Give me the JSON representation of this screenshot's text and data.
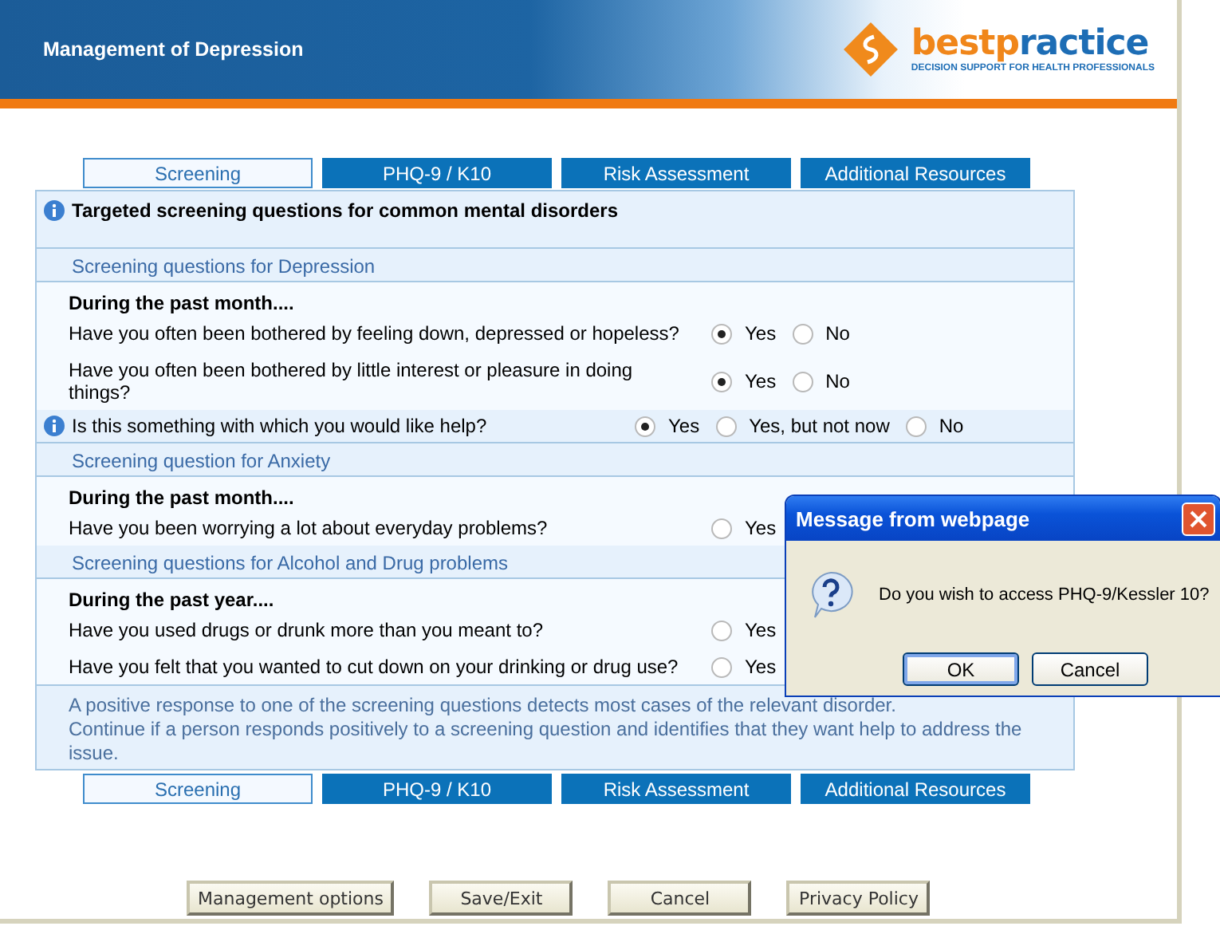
{
  "header": {
    "title": "Management of Depression",
    "logo_parts": [
      {
        "text": "bestp",
        "color": "#f0861a"
      },
      {
        "text": "ractice",
        "color": "#1d6db5"
      }
    ],
    "tagline": "DECISION SUPPORT FOR HEALTH PROFESSIONALS"
  },
  "tabs_top": [
    {
      "label": "Screening",
      "selected": true
    },
    {
      "label": "PHQ-9 / K10",
      "selected": false
    },
    {
      "label": "Risk Assessment",
      "selected": false
    },
    {
      "label": "Additional Resources",
      "selected": false
    }
  ],
  "rows": [
    {
      "kind": "intro",
      "text": "Targeted screening questions for common mental disorders"
    },
    {
      "kind": "section",
      "text": "Screening questions for Depression"
    },
    {
      "kind": "lead",
      "text": "During the past month...."
    },
    {
      "kind": "question",
      "text": "Have you often been bothered by feeling down, depressed or hopeless?",
      "options": [
        {
          "label": "Yes",
          "selected": true
        },
        {
          "label": "No",
          "selected": false
        }
      ]
    },
    {
      "kind": "question",
      "text": "Have you often been bothered by little interest or pleasure in doing things?",
      "options": [
        {
          "label": "Yes",
          "selected": true
        },
        {
          "label": "No",
          "selected": false
        }
      ]
    },
    {
      "kind": "help",
      "text": "Is this something with which you would like help?",
      "options": [
        {
          "label": "Yes",
          "selected": true
        },
        {
          "label": "Yes, but not now",
          "selected": false
        },
        {
          "label": "No",
          "selected": false
        }
      ]
    },
    {
      "kind": "section",
      "text": "Screening question for Anxiety"
    },
    {
      "kind": "lead",
      "text": "During the past month...."
    },
    {
      "kind": "question",
      "text": "Have you been worrying a lot about everyday problems?",
      "options": [
        {
          "label": "Yes",
          "selected": false
        }
      ]
    },
    {
      "kind": "section",
      "text": "Screening questions for Alcohol and Drug problems"
    },
    {
      "kind": "lead",
      "text": "During the past year...."
    },
    {
      "kind": "question",
      "text": "Have you used drugs or drunk more than you meant to?",
      "options": [
        {
          "label": "Yes",
          "selected": false
        }
      ]
    },
    {
      "kind": "question",
      "text": "Have you felt that you wanted to cut down on your drinking or drug use?",
      "options": [
        {
          "label": "Yes",
          "selected": false
        }
      ]
    },
    {
      "kind": "note",
      "lines": [
        "A positive response to one of the screening questions detects most cases of the relevant disorder.",
        "Continue if a person responds positively to a screening question and identifies that they want help to address the issue."
      ]
    }
  ],
  "tabs_bottom": [
    {
      "label": "Screening",
      "selected": true
    },
    {
      "label": "PHQ-9 / K10",
      "selected": false
    },
    {
      "label": "Risk Assessment",
      "selected": false
    },
    {
      "label": "Additional Resources",
      "selected": false
    }
  ],
  "buttons": [
    "Management options",
    "Save/Exit",
    "Cancel",
    "Privacy Policy"
  ],
  "dialog": {
    "title": "Message from webpage",
    "message": "Do you wish to access PHQ-9/Kessler 10?",
    "buttons": [
      {
        "label": "OK",
        "focused": true
      },
      {
        "label": "Cancel",
        "focused": false
      }
    ]
  }
}
